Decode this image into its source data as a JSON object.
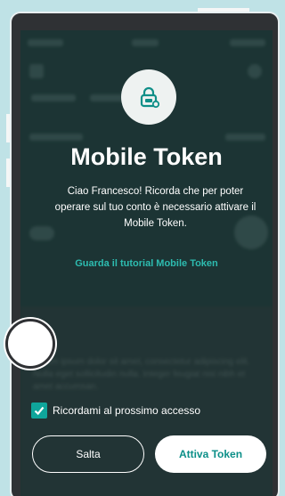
{
  "dialog": {
    "icon": "lock-icon",
    "title": "Mobile Token",
    "message": "Ciao Francesco! Ricorda che per poter operare sul tuo conto è necessario attivare il Mobile Token.",
    "tutorial_link": "Guarda il tutorial Mobile Token",
    "remember_label": "Ricordami al prossimo accesso",
    "remember_checked": true,
    "skip_label": "Salta",
    "activate_label": "Attiva Token"
  },
  "colors": {
    "accent": "#0fa59b",
    "link": "#2dbcb0",
    "overlay": "#1f3d3c"
  }
}
